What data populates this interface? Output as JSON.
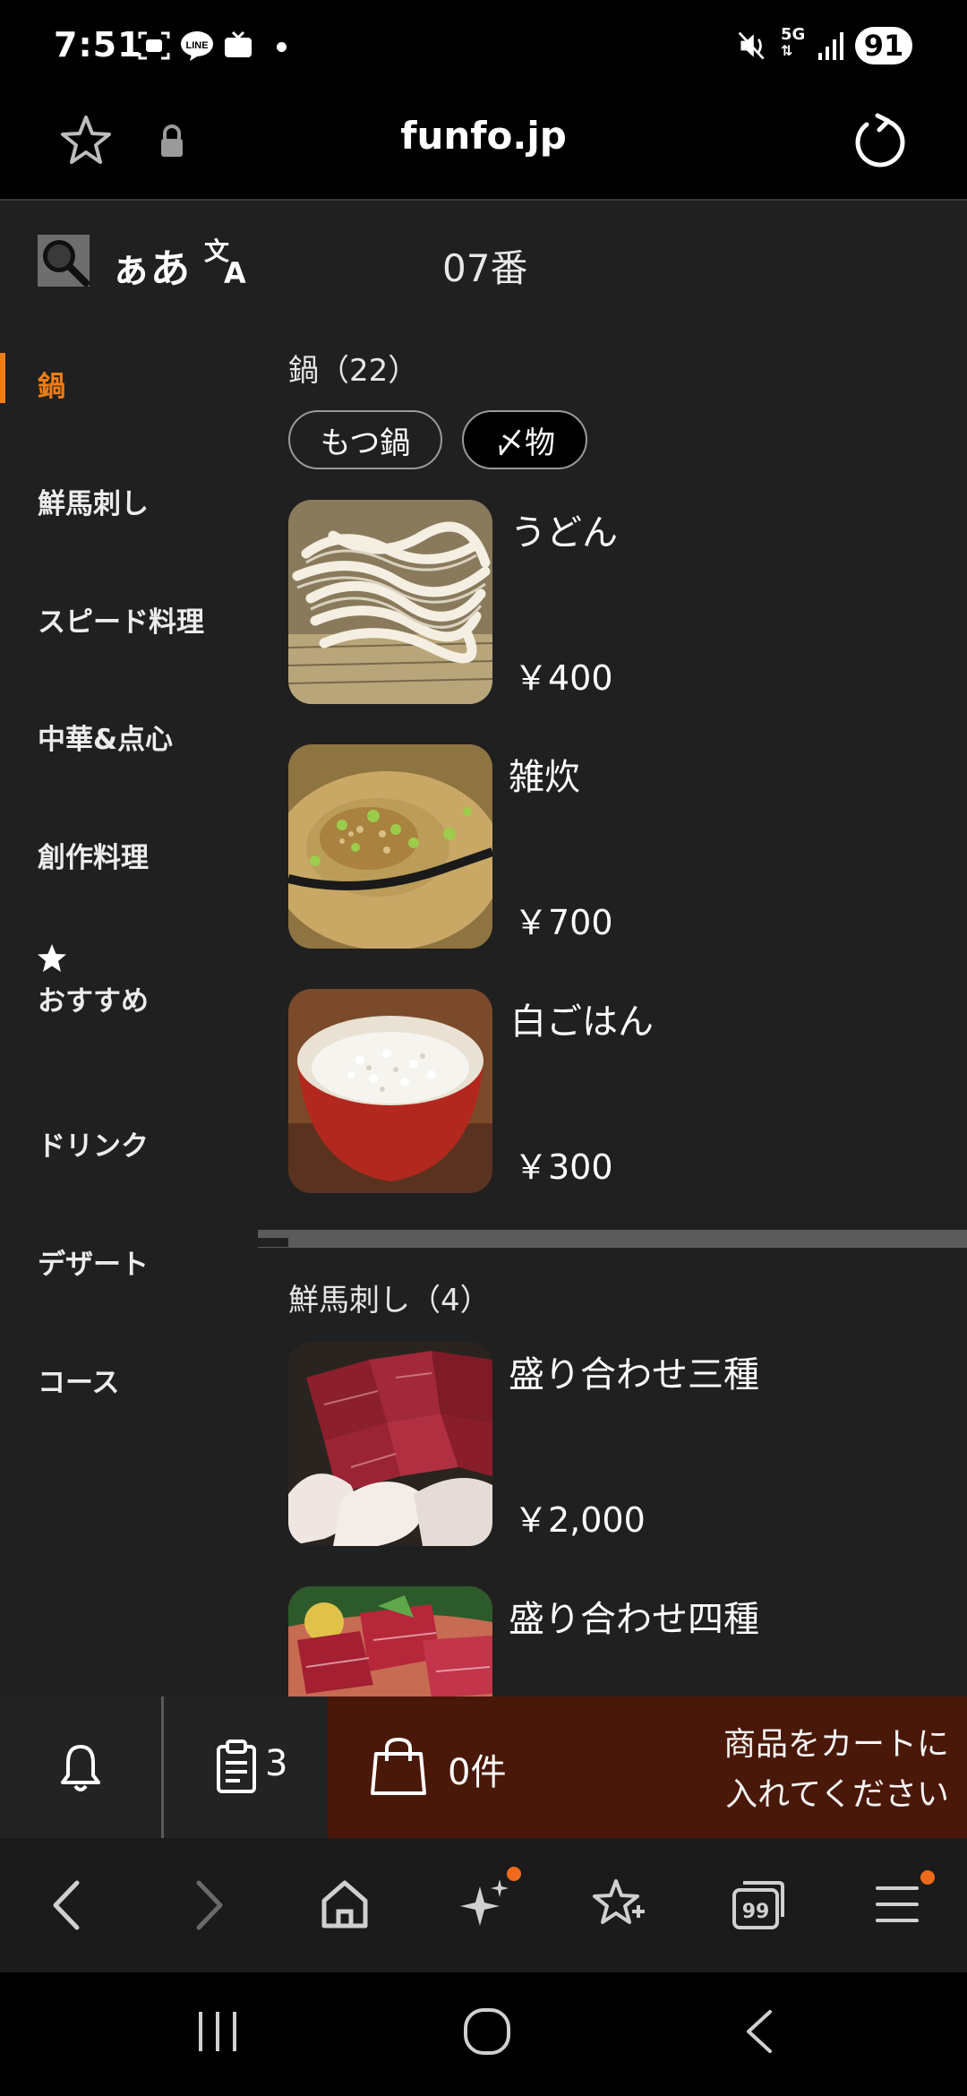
{
  "status_bar": {
    "time": "7:51",
    "network": "5G",
    "battery": "91",
    "icons": [
      "screenshot-icon",
      "line-icon",
      "tv-icon",
      "dot-icon",
      "mute-icon",
      "5g-icon",
      "signal-icon"
    ]
  },
  "browser": {
    "url": "funfo.jp",
    "icons": [
      "star-outline-icon",
      "lock-icon",
      "reload-icon"
    ]
  },
  "toolbar": {
    "text_size_label": "ぁあ",
    "table_number": "07番",
    "icons": [
      "search-icon",
      "translate-icon"
    ]
  },
  "sidebar": {
    "items": [
      {
        "label": "鍋",
        "active": true
      },
      {
        "label": "鮮馬刺し"
      },
      {
        "label": "スピード料理"
      },
      {
        "label": "中華&点心"
      },
      {
        "label": "創作料理"
      },
      {
        "label": "おすすめ",
        "icon": "star-icon"
      },
      {
        "label": "ドリンク"
      },
      {
        "label": "デザート"
      },
      {
        "label": "コース"
      }
    ],
    "accent_color": "#ef7d17"
  },
  "sections": [
    {
      "title": "鍋（22）",
      "chips": [
        {
          "label": "もつ鍋",
          "selected": false
        },
        {
          "label": "〆物",
          "selected": true
        }
      ],
      "items": [
        {
          "name": "うどん",
          "price": "￥400"
        },
        {
          "name": "雑炊",
          "price": "￥700"
        },
        {
          "name": "白ごはん",
          "price": "￥300"
        }
      ]
    },
    {
      "title": "鮮馬刺し（4）",
      "items": [
        {
          "name": "盛り合わせ三種",
          "price": "￥2,000"
        },
        {
          "name": "盛り合わせ四種",
          "price": ""
        }
      ]
    }
  ],
  "order_bar": {
    "order_count": "3",
    "cart_count": "0件",
    "cart_message_line1": "商品をカートに",
    "cart_message_line2": "入れてください",
    "icons": [
      "bell-icon",
      "clipboard-icon",
      "shopping-bag-icon"
    ],
    "cart_color": "#4a1808"
  },
  "browser_nav": {
    "icons": [
      "back-icon",
      "forward-icon",
      "home-icon",
      "ai-sparkle-icon",
      "bookmark-add-icon",
      "tabs-icon",
      "menu-icon"
    ],
    "tabs_count": "99"
  },
  "system_nav": {
    "icons": [
      "recent-apps-icon",
      "home-circle-icon",
      "system-back-icon"
    ]
  }
}
